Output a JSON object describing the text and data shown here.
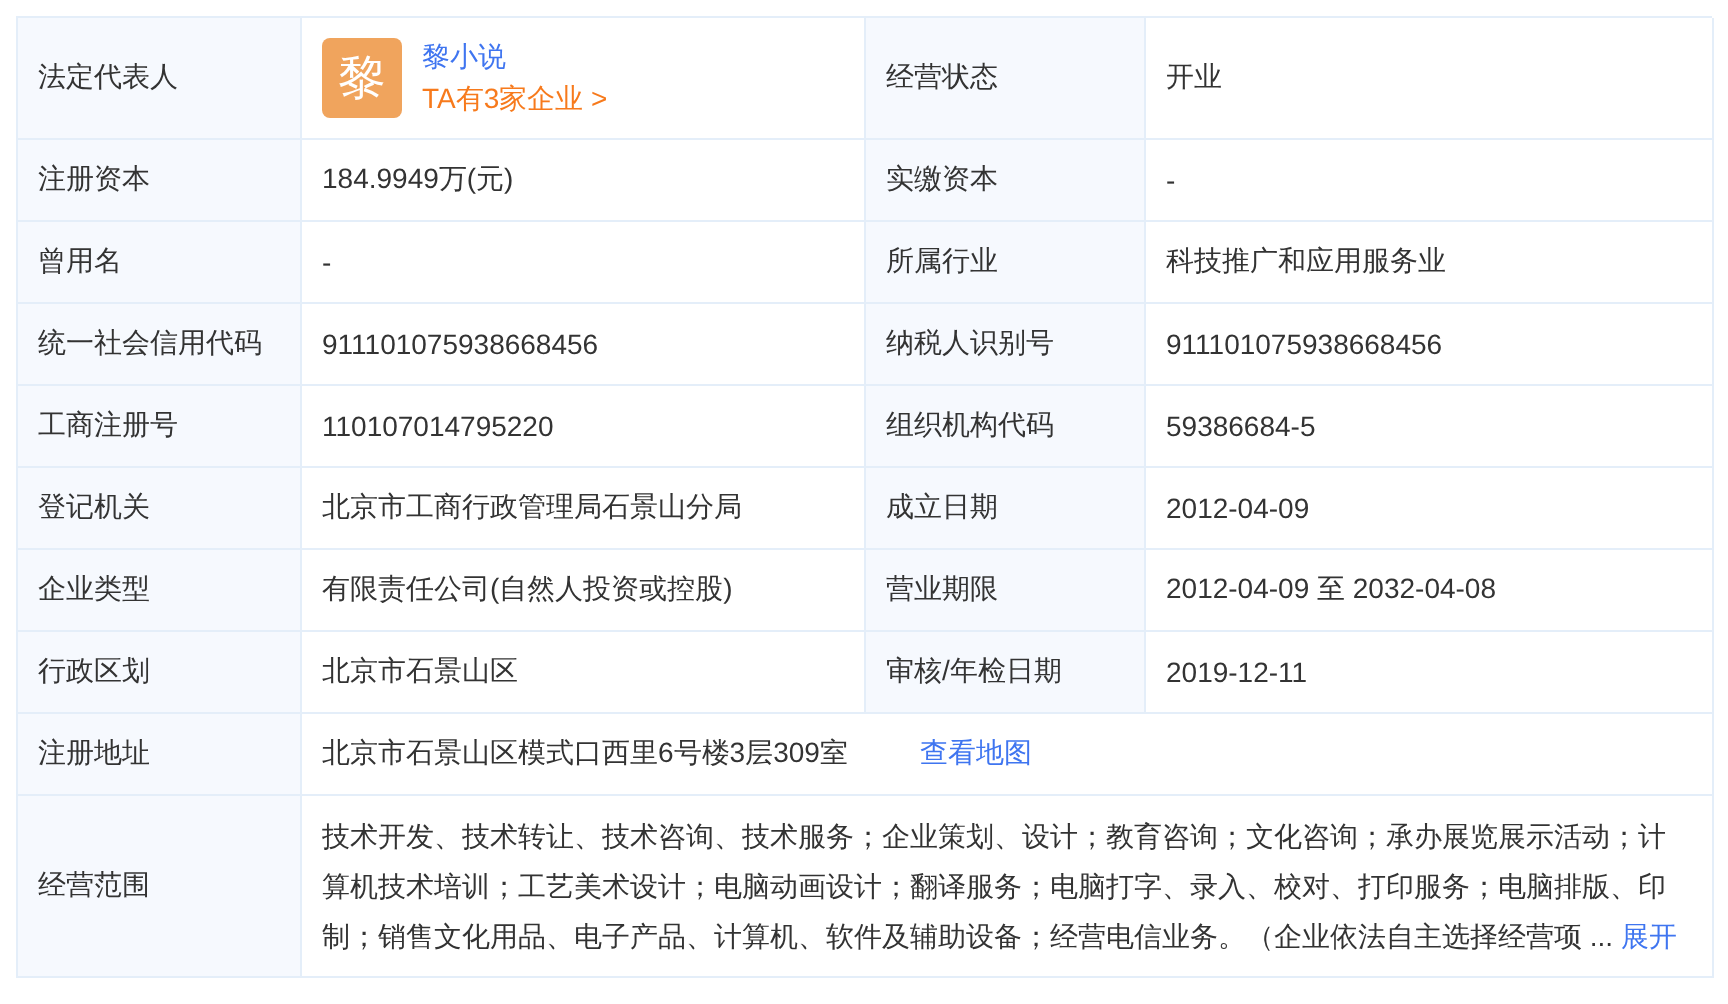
{
  "legal_rep": {
    "label": "法定代表人",
    "avatar": "黎",
    "name": "黎小说",
    "companies_link": "TA有3家企业 >"
  },
  "rows": [
    {
      "kind": "pair",
      "label": "经营状态",
      "value": "开业"
    },
    {
      "kind": "pair",
      "label": "注册资本",
      "value": "184.9949万(元)",
      "label2": "实缴资本",
      "value2": "-"
    },
    {
      "kind": "pair",
      "label": "曾用名",
      "value": "-",
      "label2": "所属行业",
      "value2": "科技推广和应用服务业"
    },
    {
      "kind": "pair",
      "label": "统一社会信用代码",
      "value": "911101075938668456",
      "label2": "纳税人识别号",
      "value2": "911101075938668456"
    },
    {
      "kind": "pair",
      "label": "工商注册号",
      "value": "110107014795220",
      "label2": "组织机构代码",
      "value2": "59386684-5"
    },
    {
      "kind": "pair",
      "label": "登记机关",
      "value": "北京市工商行政管理局石景山分局",
      "label2": "成立日期",
      "value2": "2012-04-09"
    },
    {
      "kind": "pair",
      "label": "企业类型",
      "value": "有限责任公司(自然人投资或控股)",
      "label2": "营业期限",
      "value2": "2012-04-09 至 2032-04-08"
    },
    {
      "kind": "pair",
      "label": "行政区划",
      "value": "北京市石景山区",
      "label2": "审核/年检日期",
      "value2": "2019-12-11"
    },
    {
      "kind": "address",
      "label": "注册地址",
      "value": "北京市石景山区模式口西里6号楼3层309室",
      "link": "查看地图"
    },
    {
      "kind": "scope",
      "label": "经营范围",
      "value": "技术开发、技术转让、技术咨询、技术服务；企业策划、设计；教育咨询；文化咨询；承办展览展示活动；计算机技术培训；工艺美术设计；电脑动画设计；翻译服务；电脑打字、录入、校对、打印服务；电脑排版、印制；销售文化用品、电子产品、计算机、软件及辅助设备；经营电信业务。（企业依法自主选择经营项",
      "ellipsis": "...",
      "link": "展开"
    }
  ]
}
